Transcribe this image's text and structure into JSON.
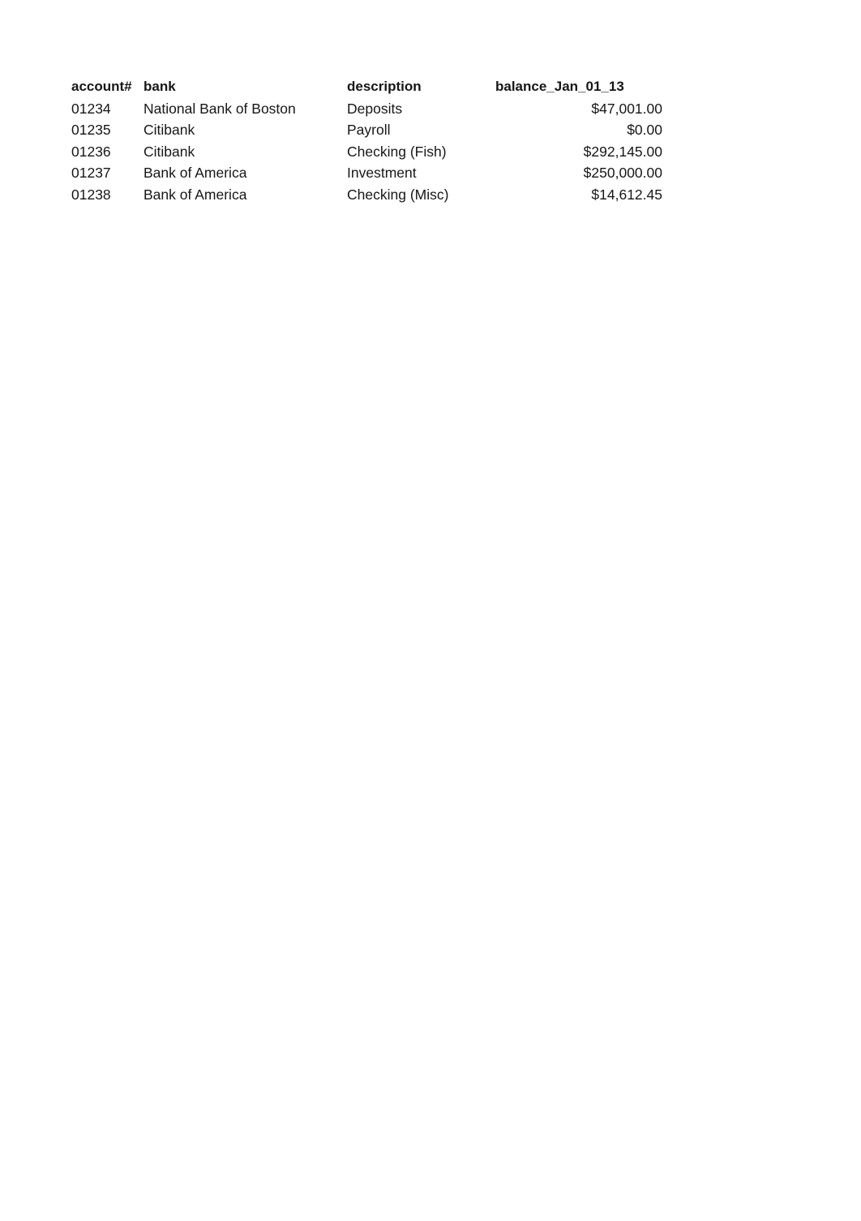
{
  "sheet": {
    "background_color": "#ffffff",
    "text_color": "#171717"
  },
  "table": {
    "headers": {
      "account": "account#",
      "bank": "bank",
      "description": "description",
      "balance": "balance_Jan_01_13"
    },
    "rows": [
      {
        "account": "01234",
        "bank": "National Bank of Boston",
        "description": "Deposits",
        "balance": "$47,001.00"
      },
      {
        "account": "01235",
        "bank": "Citibank",
        "description": "Payroll",
        "balance": "$0.00"
      },
      {
        "account": "01236",
        "bank": "Citibank",
        "description": "Checking (Fish)",
        "balance": "$292,145.00"
      },
      {
        "account": "01237",
        "bank": "Bank of America",
        "description": "Investment",
        "balance": "$250,000.00"
      },
      {
        "account": "01238",
        "bank": "Bank of America",
        "description": "Checking (Misc)",
        "balance": "$14,612.45"
      }
    ]
  }
}
